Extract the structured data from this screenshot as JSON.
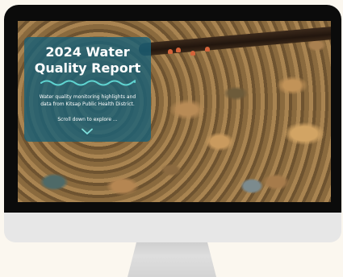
{
  "hero": {
    "title_line1": "2024 Water",
    "title_line2": "Quality Report",
    "description_line1": "Water quality monitoring highlights and",
    "description_line2": "data from Kitsap Public Health District.",
    "scroll_prompt": "Scroll down to explore ...",
    "accent_color": "#1a6078",
    "wave_color": "#5fd3d0"
  },
  "icons": {
    "wave": "wave-divider-icon",
    "scroll": "chevron-down-icon"
  }
}
